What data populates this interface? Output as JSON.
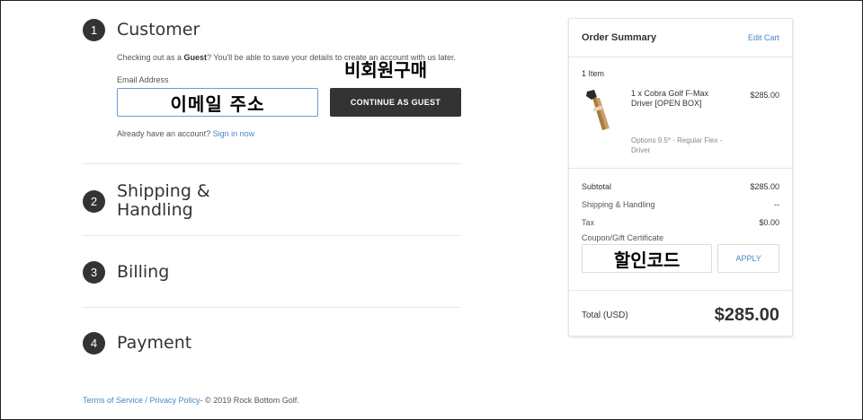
{
  "steps": [
    {
      "num": "1",
      "title": "Customer"
    },
    {
      "num": "2",
      "title": "Shipping &\nHandling"
    },
    {
      "num": "3",
      "title": "Billing"
    },
    {
      "num": "4",
      "title": "Payment"
    }
  ],
  "customer": {
    "guest_note_pre": "Checking out as a ",
    "guest_note_bold": "Guest",
    "guest_note_post": "? You'll be able to save your details to create an account with us later.",
    "email_label": "Email Address",
    "email_overlay": "이메일 주소",
    "guest_overlay": "비회원구매",
    "continue_label": "CONTINUE AS GUEST",
    "already_text": "Already have an account?",
    "signin_label": "Sign in now"
  },
  "footer": {
    "terms": "Terms of Service",
    "sep": " / ",
    "privacy": "Privacy Policy",
    "copyright": "- © 2019 Rock Bottom Golf."
  },
  "summary": {
    "title": "Order Summary",
    "edit_cart": "Edit Cart",
    "item_count": "1 Item",
    "item": {
      "name": "1 x Cobra Golf F-Max Driver [OPEN BOX]",
      "price": "$285.00",
      "options": "Options 9.5* - Regular Flex - Driver"
    },
    "subtotal_label": "Subtotal",
    "subtotal_value": "$285.00",
    "shipping_label": "Shipping & Handling",
    "shipping_value": "--",
    "tax_label": "Tax",
    "tax_value": "$0.00",
    "coupon_label": "Coupon/Gift Certificate",
    "coupon_overlay": "할인코드",
    "apply_label": "APPLY",
    "total_label": "Total (USD)",
    "total_value": "$285.00"
  },
  "colors": {
    "accent_link": "#4a86c7",
    "dark_button": "#333333",
    "input_focus": "#6b9bd1"
  }
}
